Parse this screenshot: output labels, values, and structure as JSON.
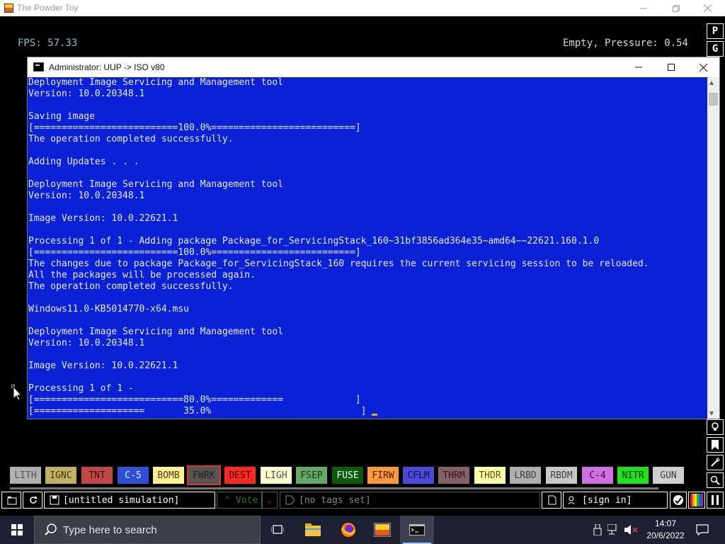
{
  "window": {
    "title": "The Powder Toy",
    "minimize_glyph": "—",
    "restore_glyph": "❐",
    "close_glyph": "✕"
  },
  "hud": {
    "fps": "FPS: 57.33",
    "status": "Empty, Pressure: 0.54"
  },
  "right_buttons": {
    "top": [
      "P",
      "G"
    ]
  },
  "cmd": {
    "title": "Administrator:  UUP -> ISO v80",
    "lines": [
      "Deployment Image Servicing and Management tool",
      "Version: 10.0.20348.1",
      "",
      "Saving image",
      "[==========================100.0%==========================]",
      "The operation completed successfully.",
      "",
      "Adding Updates . . .",
      "",
      "Deployment Image Servicing and Management tool",
      "Version: 10.0.20348.1",
      "",
      "Image Version: 10.0.22621.1",
      "",
      "Processing 1 of 1 - Adding package Package_for_ServicingStack_160~31bf3856ad364e35~amd64~~22621.160.1.0",
      "[==========================100.0%==========================]",
      "The changes due to package Package_for_ServicingStack_160 requires the current servicing session to be reloaded.",
      "All the packages will be processed again.",
      "The operation completed successfully.",
      "",
      "Windows11.0-KB5014770-x64.msu",
      "",
      "Deployment Image Servicing and Management tool",
      "Version: 10.0.20348.1",
      "",
      "Image Version: 10.0.22621.1",
      "",
      "Processing 1 of 1 -",
      "[===========================80.0%=============             ]",
      "[====================       35.0%                           ] "
    ]
  },
  "elements": [
    {
      "label": "LITH",
      "bg": "#b0b0b0",
      "fg": "#555555"
    },
    {
      "label": "IGNC",
      "bg": "#c0b060",
      "fg": "#404020"
    },
    {
      "label": "TNT",
      "bg": "#c04848",
      "fg": "#3a1010"
    },
    {
      "label": "C-5",
      "bg": "#3050d8",
      "fg": "#e8e8ff"
    },
    {
      "label": "BOMB",
      "bg": "#fff090",
      "fg": "#404020"
    },
    {
      "label": "FWRK",
      "bg": "#555555",
      "fg": "#222222"
    },
    {
      "label": "DEST",
      "bg": "#ff2828",
      "fg": "#3a0808"
    },
    {
      "label": "LIGH",
      "bg": "#fffdd0",
      "fg": "#505050"
    },
    {
      "label": "FSEP",
      "bg": "#66a866",
      "fg": "#183818"
    },
    {
      "label": "FUSE",
      "bg": "#0a5a0a",
      "fg": "#e8ffe8"
    },
    {
      "label": "FIRW",
      "bg": "#ff9a3a",
      "fg": "#402008"
    },
    {
      "label": "CFLM",
      "bg": "#4a4ad8",
      "fg": "#101040"
    },
    {
      "label": "THRM",
      "bg": "#886068",
      "fg": "#281818"
    },
    {
      "label": "THDR",
      "bg": "#ffffa8",
      "fg": "#505020"
    },
    {
      "label": "LRBD",
      "bg": "#b0b0b0",
      "fg": "#404040"
    },
    {
      "label": "RBDM",
      "bg": "#c8c8c8",
      "fg": "#404040"
    },
    {
      "label": "C-4",
      "bg": "#d070e0",
      "fg": "#301038"
    },
    {
      "label": "NITR",
      "bg": "#20e020",
      "fg": "#083008"
    },
    {
      "label": "GUN",
      "bg": "#d0d0d0",
      "fg": "#404040"
    }
  ],
  "bottom_bar": {
    "simulation_name": "[untitled simulation]",
    "vote_label": "Vote",
    "tags_label": "[no tags set]",
    "sign_in_label": "[sign in]"
  },
  "taskbar": {
    "search_placeholder": "Type here to search",
    "time": "14:07",
    "date": "20/6/2022"
  },
  "colors": {
    "cmd_background": "#0a21d6",
    "fps_color": "#7ec3d8",
    "selected_element_outline": "#e03030"
  },
  "icons": {
    "start": "windows-logo-icon",
    "search": "search-icon",
    "task_view": "task-view-icon",
    "explorer": "file-explorer-icon",
    "firefox": "firefox-icon",
    "powder_toy": "powder-toy-icon",
    "terminal": "terminal-icon"
  }
}
